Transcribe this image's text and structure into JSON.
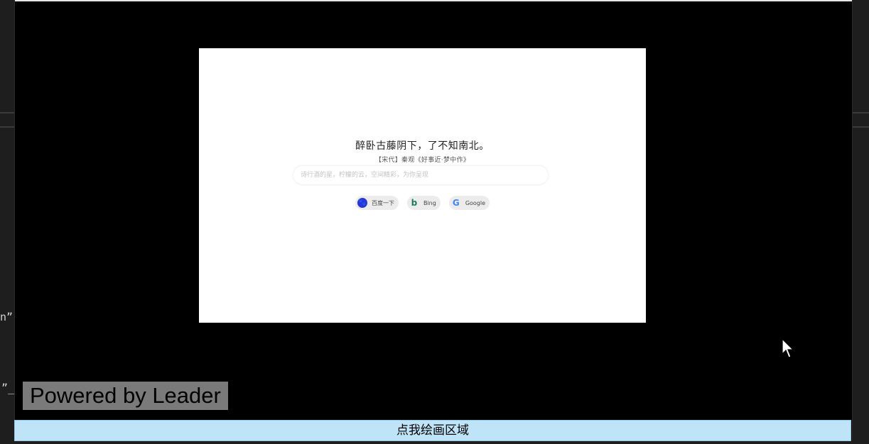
{
  "background": {
    "code_fragment_1": "n”)",
    "code_fragment_2": "”_"
  },
  "preview": {
    "quote": "醉卧古藤阴下，了不知南北。",
    "source": "【宋代】秦观《好事近·梦中作》",
    "search_placeholder": "诗行酒的星，柠檬的云，空间精彩，为你呈现",
    "engines": [
      {
        "label": "百度一下",
        "icon": "baidu-icon"
      },
      {
        "label": "Bing",
        "icon": "bing-icon"
      },
      {
        "label": "Google",
        "icon": "google-icon"
      }
    ]
  },
  "watermark": "Powered by Leader",
  "draw_bar_label": "点我绘画区域",
  "colors": {
    "overlay": "#000000",
    "draw_bar": "#bfe4f8",
    "watermark_bg": "#7a7a7a"
  }
}
